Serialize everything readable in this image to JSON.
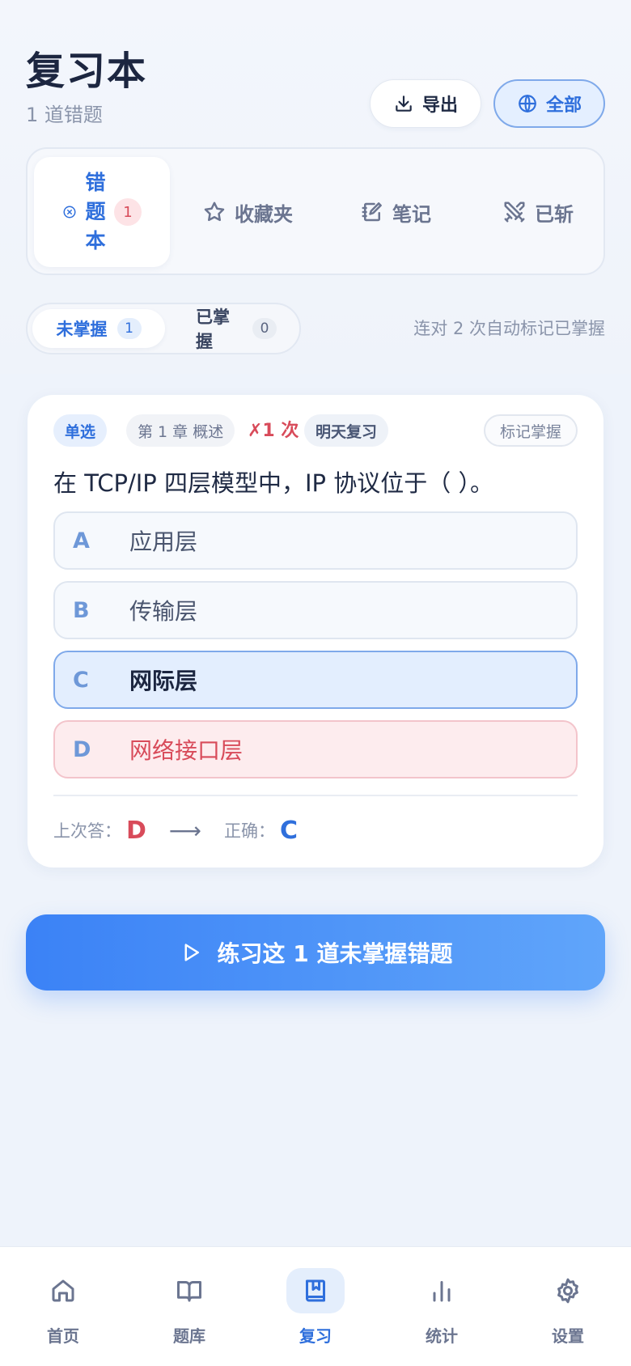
{
  "header": {
    "title": "复习本",
    "subtitle": "1 道错题",
    "export_label": "导出",
    "all_label": "全部"
  },
  "tabs": {
    "wrong": {
      "label": "错题本",
      "count": "1"
    },
    "favorites": {
      "label": "收藏夹"
    },
    "notes": {
      "label": "笔记"
    },
    "done": {
      "label": "已斩"
    }
  },
  "segment": {
    "unmastered": {
      "label": "未掌握",
      "count": "1"
    },
    "mastered": {
      "label": "已掌握",
      "count": "0"
    },
    "hint": "连对 2 次自动标记已掌握"
  },
  "question_card": {
    "type": "单选",
    "chapter": "第 1 章 概述",
    "wrong_count": "✗1 次",
    "review": "明天复习",
    "mark_label": "标记掌握",
    "question": "在 TCP/IP 四层模型中，IP 协议位于（ ）。",
    "options": [
      {
        "letter": "A",
        "text": "应用层"
      },
      {
        "letter": "B",
        "text": "传输层"
      },
      {
        "letter": "C",
        "text": "网际层"
      },
      {
        "letter": "D",
        "text": "网络接口层"
      }
    ],
    "last_label": "上次答：",
    "last_answer": "D",
    "arrow": "⟶",
    "correct_label": "正确：",
    "correct_answer": "C"
  },
  "practice_button": {
    "label": "练习这 1 道未掌握错题"
  },
  "bottom_nav": {
    "items": [
      {
        "label": "首页",
        "icon": "home-icon"
      },
      {
        "label": "题库",
        "icon": "book-open-icon"
      },
      {
        "label": "复习",
        "icon": "bookmark-book-icon",
        "active": true
      },
      {
        "label": "统计",
        "icon": "bar-chart-icon"
      },
      {
        "label": "设置",
        "icon": "gear-icon"
      }
    ]
  },
  "colors": {
    "accent": "#2f6fdc",
    "danger": "#d84b5a",
    "background": "#eef3fb"
  }
}
